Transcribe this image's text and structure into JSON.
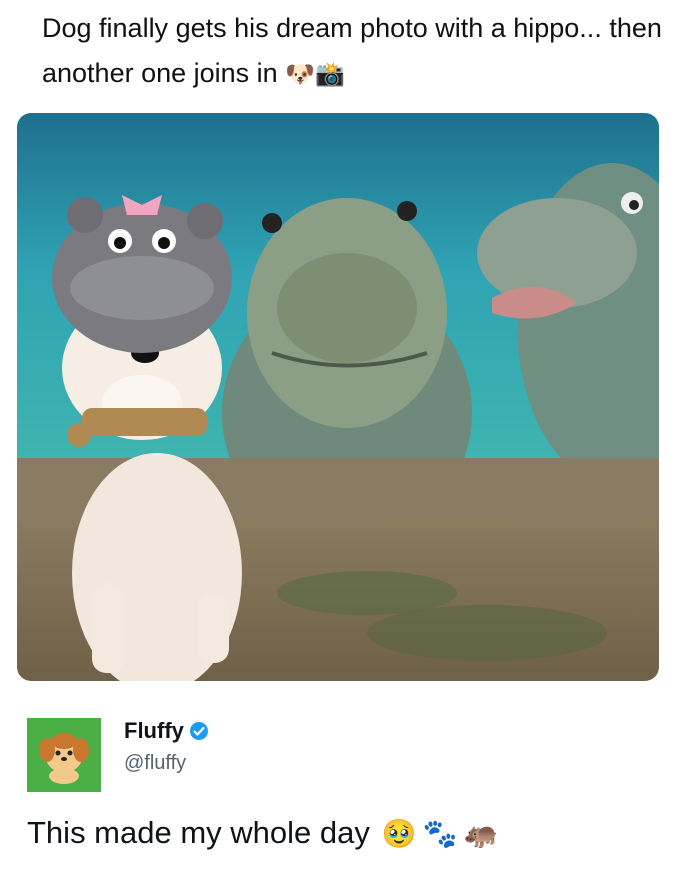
{
  "headline": {
    "text": "Dog finally gets his dream photo with a hippo... then another one joins in",
    "emojis": "🐶📸"
  },
  "image": {
    "description_icon": "photo-image"
  },
  "author": {
    "name": "Fluffy",
    "handle": "@fluffy",
    "avatar_icon": "dog-avatar-icon",
    "verified_icon": "verified-badge-icon",
    "colors": {
      "avatar_bg": "#4caf46",
      "verified": "#1d9bf0"
    }
  },
  "post": {
    "text": "This made my whole day",
    "emojis": "🥹🐾🦛"
  }
}
